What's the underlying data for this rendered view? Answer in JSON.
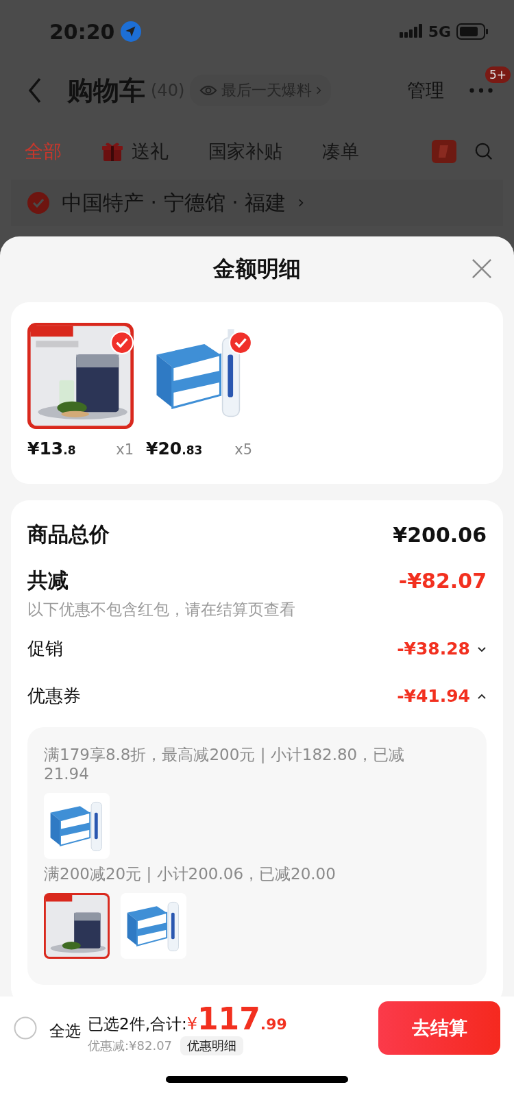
{
  "status_bar": {
    "time": "20:20",
    "network": "5G"
  },
  "header": {
    "title": "购物车",
    "count": "(40)",
    "promo": "最后一天爆料",
    "manage": "管理",
    "more_badge": "5+"
  },
  "tabs": [
    {
      "label": "全部",
      "selected": true,
      "kind": "text"
    },
    {
      "label": "送礼",
      "selected": false,
      "kind": "gift"
    },
    {
      "label": "国家补贴",
      "selected": false,
      "kind": "text"
    },
    {
      "label": "凑单",
      "selected": false,
      "kind": "text"
    }
  ],
  "store": {
    "name": "中国特产 · 宁德馆 · 福建",
    "checked": true
  },
  "sheet": {
    "title": "金额明细"
  },
  "products": [
    {
      "price_int": "¥13",
      "price_dec": ".8",
      "qty": "x1",
      "checked": true,
      "framed": true
    },
    {
      "price_int": "¥20",
      "price_dec": ".83",
      "qty": "x5",
      "checked": true,
      "framed": false
    }
  ],
  "summary": {
    "total_label": "商品总价",
    "total": "¥200.06",
    "discount_label": "共减",
    "discount": "-¥82.07",
    "note": "以下优惠不包含红包，请在结算页查看"
  },
  "discount_rows": [
    {
      "label": "促销",
      "amount": "-¥38.28",
      "expanded": false
    },
    {
      "label": "优惠券",
      "amount": "-¥41.94",
      "expanded": true
    }
  ],
  "coupons": [
    {
      "text": "满179享8.8折，最高减200元 | 小计182.80，已减21.94",
      "items": [
        {
          "framed": false
        }
      ]
    },
    {
      "text": "满200减20元 | 小计200.06，已减20.00",
      "items": [
        {
          "framed": true
        },
        {
          "framed": false
        }
      ]
    }
  ],
  "bottom": {
    "select_all": "全选",
    "checked": false,
    "selected_text": "已选2件,合计:",
    "currency": "¥",
    "amount_int": "117",
    "amount_dec": ".99",
    "saved": "优惠减:¥82.07",
    "detail_button": "优惠明细",
    "checkout": "去结算"
  }
}
